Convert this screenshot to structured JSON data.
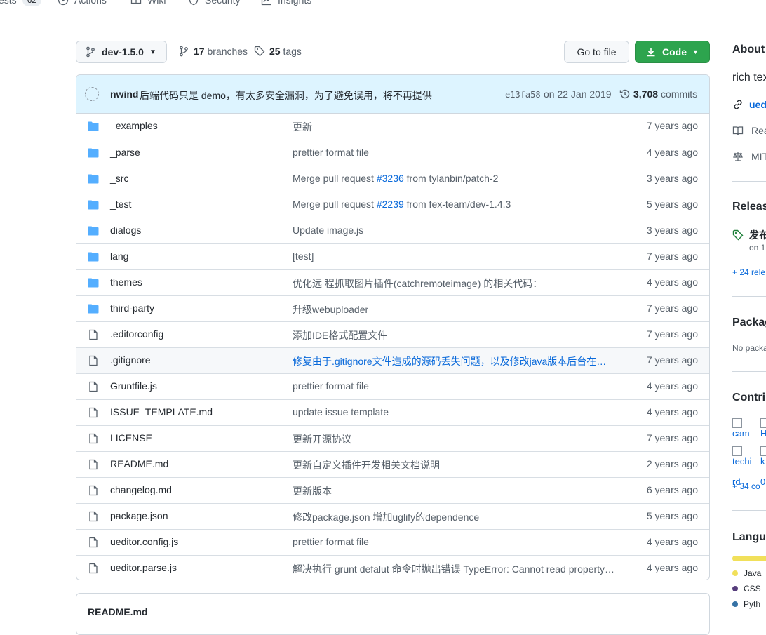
{
  "repo_nav": {
    "tests_label": "ests",
    "tests_count": "62",
    "actions_label": "Actions",
    "wiki_label": "Wiki",
    "security_label": "Security",
    "insights_label": "Insights"
  },
  "toolbar": {
    "branch_name": "dev-1.5.0",
    "branches_count": "17",
    "branches_label": "branches",
    "tags_count": "25",
    "tags_label": "tags",
    "go_to_file": "Go to file",
    "code_label": "Code"
  },
  "latest_commit": {
    "author": "nwind",
    "message": "后端代码只是 demo，有太多安全漏洞，为了避免误用，将不再提供",
    "sha": "e13fa58",
    "date": "on 22 Jan 2019",
    "commits_count": "3,708",
    "commits_label": "commits"
  },
  "files": [
    {
      "type": "dir",
      "name": "_examples",
      "message": "更新",
      "age": "7 years ago"
    },
    {
      "type": "dir",
      "name": "_parse",
      "message": "prettier format file",
      "age": "4 years ago"
    },
    {
      "type": "dir",
      "name": "_src",
      "message_pre": "Merge pull request ",
      "message_pr": "#3236",
      "message_post": " from tylanbin/patch-2",
      "age": "3 years ago"
    },
    {
      "type": "dir",
      "name": "_test",
      "message_pre": "Merge pull request ",
      "message_pr": "#2239",
      "message_post": " from fex-team/dev-1.4.3",
      "age": "5 years ago"
    },
    {
      "type": "dir",
      "name": "dialogs",
      "message": "Update image.js",
      "age": "3 years ago"
    },
    {
      "type": "dir",
      "name": "lang",
      "message": "[test]",
      "age": "7 years ago"
    },
    {
      "type": "dir",
      "name": "themes",
      "message": "优化远 程抓取图片插件(catchremoteimage) 的相关代码：",
      "age": "4 years ago"
    },
    {
      "type": "dir",
      "name": "third-party",
      "message": "升级webuploader",
      "age": "7 years ago"
    },
    {
      "type": "file",
      "name": ".editorconfig",
      "message": "添加IDE格式配置文件",
      "age": "7 years ago"
    },
    {
      "type": "file",
      "name": ".gitignore",
      "message": "修复由于.gitignore文件造成的源码丢失问题，以及修改java版本后台在上…",
      "age": "7 years ago",
      "hover": true
    },
    {
      "type": "file",
      "name": "Gruntfile.js",
      "message": "prettier format file",
      "age": "4 years ago"
    },
    {
      "type": "file",
      "name": "ISSUE_TEMPLATE.md",
      "message": "update issue template",
      "age": "4 years ago"
    },
    {
      "type": "file",
      "name": "LICENSE",
      "message": "更新开源协议",
      "age": "7 years ago"
    },
    {
      "type": "file",
      "name": "README.md",
      "message": "更新自定义插件开发相关文档说明",
      "age": "2 years ago"
    },
    {
      "type": "file",
      "name": "changelog.md",
      "message": "更新版本",
      "age": "6 years ago"
    },
    {
      "type": "file",
      "name": "package.json",
      "message": "修改package.json 增加uglify的dependence",
      "age": "5 years ago"
    },
    {
      "type": "file",
      "name": "ueditor.config.js",
      "message": "prettier format file",
      "age": "4 years ago"
    },
    {
      "type": "file",
      "name": "ueditor.parse.js",
      "message": "解决执行 grunt defalut 命令时抛出错误 TypeError: Cannot read property …",
      "age": "4 years ago"
    }
  ],
  "readme": {
    "title": "README.md"
  },
  "sidebar": {
    "about_heading": "About",
    "description": "rich tex",
    "homepage": "ued",
    "readme_link": "Rea",
    "license": "MIT",
    "releases_heading": "Release",
    "release_name": "发布",
    "release_date": "on 1(",
    "more_releases": "+ 24 rele",
    "packages_heading": "Packag",
    "packages_text": "No packa",
    "contributors_heading": "Contrib",
    "contributor_alts": [
      "cam",
      "H",
      "techi",
      "k"
    ],
    "contributor_extra": "rd",
    "contributor_extra2": "0",
    "more_contributors": "+ 34 co",
    "languages_heading": "Langua",
    "languages": [
      {
        "name": "Java",
        "color": "#f1e05a"
      },
      {
        "name": "CSS",
        "color": "#563d7c"
      },
      {
        "name": "Pyth",
        "color": "#3572A5"
      }
    ]
  },
  "colors": {
    "primary_button": "#2da44e",
    "link": "#0969da",
    "folder": "#54aeff",
    "commit_bar": "#ddf4ff"
  }
}
